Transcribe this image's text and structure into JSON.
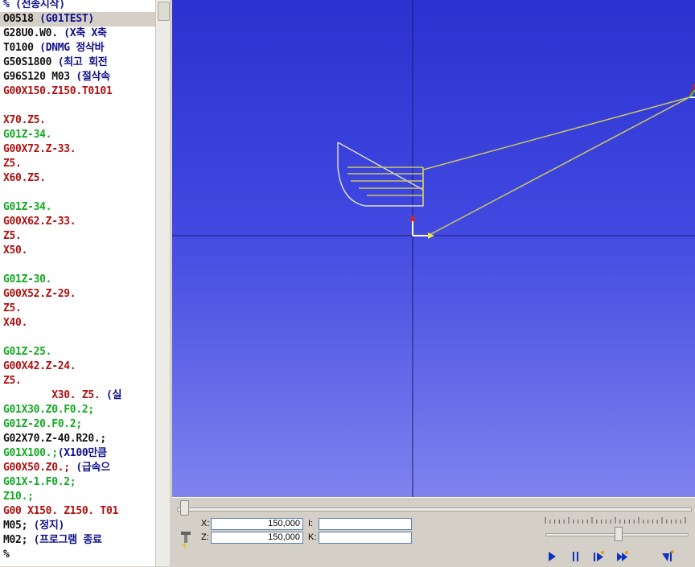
{
  "code_lines": [
    {
      "segments": [
        {
          "t": "% (전송시작)",
          "c": "c-blue"
        }
      ]
    },
    {
      "selected": true,
      "segments": [
        {
          "t": "O0518 ",
          "c": "c-black"
        },
        {
          "t": "(G01TEST)",
          "c": "c-blue"
        }
      ]
    },
    {
      "segments": [
        {
          "t": "G28U0.W0. ",
          "c": "c-black"
        },
        {
          "t": "(X축 X축",
          "c": "c-blue"
        }
      ]
    },
    {
      "segments": [
        {
          "t": "T0100 ",
          "c": "c-black"
        },
        {
          "t": "(DNMG 정삭바",
          "c": "c-blue"
        }
      ]
    },
    {
      "segments": [
        {
          "t": "G50S1800 ",
          "c": "c-black"
        },
        {
          "t": "(최고 회전",
          "c": "c-blue"
        }
      ]
    },
    {
      "segments": [
        {
          "t": "G96S120 M03 ",
          "c": "c-black"
        },
        {
          "t": "(절삭속",
          "c": "c-blue"
        }
      ]
    },
    {
      "segments": [
        {
          "t": "G00X150.Z150.T0101",
          "c": "c-red"
        }
      ]
    },
    {
      "segments": []
    },
    {
      "segments": [
        {
          "t": "X70.Z5.",
          "c": "c-red"
        }
      ]
    },
    {
      "segments": [
        {
          "t": "G01Z-34.",
          "c": "c-green"
        }
      ]
    },
    {
      "segments": [
        {
          "t": "G00X72.Z-33.",
          "c": "c-red"
        }
      ]
    },
    {
      "segments": [
        {
          "t": "Z5.",
          "c": "c-red"
        }
      ]
    },
    {
      "segments": [
        {
          "t": "X60.Z5.",
          "c": "c-red"
        }
      ]
    },
    {
      "segments": []
    },
    {
      "segments": [
        {
          "t": "G01Z-34.",
          "c": "c-green"
        }
      ]
    },
    {
      "segments": [
        {
          "t": "G00X62.Z-33.",
          "c": "c-red"
        }
      ]
    },
    {
      "segments": [
        {
          "t": "Z5.",
          "c": "c-red"
        }
      ]
    },
    {
      "segments": [
        {
          "t": "X50.",
          "c": "c-red"
        }
      ]
    },
    {
      "segments": []
    },
    {
      "segments": [
        {
          "t": "G01Z-30.",
          "c": "c-green"
        }
      ]
    },
    {
      "segments": [
        {
          "t": "G00X52.Z-29.",
          "c": "c-red"
        }
      ]
    },
    {
      "segments": [
        {
          "t": "Z5.",
          "c": "c-red"
        }
      ]
    },
    {
      "segments": [
        {
          "t": "X40.",
          "c": "c-red"
        }
      ]
    },
    {
      "segments": []
    },
    {
      "segments": [
        {
          "t": "G01Z-25.",
          "c": "c-green"
        }
      ]
    },
    {
      "segments": [
        {
          "t": "G00X42.Z-24.",
          "c": "c-red"
        }
      ]
    },
    {
      "segments": [
        {
          "t": "Z5.",
          "c": "c-red"
        }
      ]
    },
    {
      "segments": [
        {
          "t": "        X30. Z5. ",
          "c": "c-red"
        },
        {
          "t": "(실",
          "c": "c-blue"
        }
      ]
    },
    {
      "segments": [
        {
          "t": "G01X30.Z0.F0.2;",
          "c": "c-green"
        }
      ]
    },
    {
      "segments": [
        {
          "t": "G01Z-20.F0.2;",
          "c": "c-green"
        }
      ]
    },
    {
      "segments": [
        {
          "t": "G02X70.Z-40.R20.;",
          "c": "c-black"
        }
      ]
    },
    {
      "segments": [
        {
          "t": "G01X100.;",
          "c": "c-green"
        },
        {
          "t": "(X100만큼",
          "c": "c-blue"
        }
      ]
    },
    {
      "segments": [
        {
          "t": "G00X50.Z0.; ",
          "c": "c-red"
        },
        {
          "t": "(급속으",
          "c": "c-blue"
        }
      ]
    },
    {
      "segments": [
        {
          "t": "G01X-1.F0.2;",
          "c": "c-green"
        }
      ]
    },
    {
      "segments": [
        {
          "t": "Z10.;",
          "c": "c-green"
        }
      ]
    },
    {
      "segments": [
        {
          "t": "G00 X150. Z150. T01",
          "c": "c-red"
        }
      ]
    },
    {
      "segments": [
        {
          "t": "M05; ",
          "c": "c-black"
        },
        {
          "t": "(정지)",
          "c": "c-blue"
        }
      ]
    },
    {
      "segments": [
        {
          "t": "M02; ",
          "c": "c-black"
        },
        {
          "t": "(프로그램 종료",
          "c": "c-blue"
        }
      ]
    },
    {
      "segments": [
        {
          "t": "%",
          "c": "c-black"
        }
      ]
    }
  ],
  "colors": {
    "toolpath": "#c9c860",
    "part_profile": "#e0e0d8",
    "axis_line": "#1a1c6e",
    "axis_x_arrow": "#e8e840",
    "axis_z_arrow": "#d82020"
  },
  "controls": {
    "x_label": "X:",
    "x_value": "150,000",
    "z_label": "Z:",
    "z_value": "150,000",
    "i_label": "I:",
    "i_value": "",
    "k_label": "K:",
    "k_value": ""
  },
  "playback_buttons": [
    {
      "name": "play-icon"
    },
    {
      "name": "pause-icon"
    },
    {
      "name": "step-icon"
    },
    {
      "name": "fast-forward-icon"
    },
    {
      "name": "skip-to-end-icon"
    }
  ],
  "timeline_position": 0.0,
  "speed_position": 0.5
}
